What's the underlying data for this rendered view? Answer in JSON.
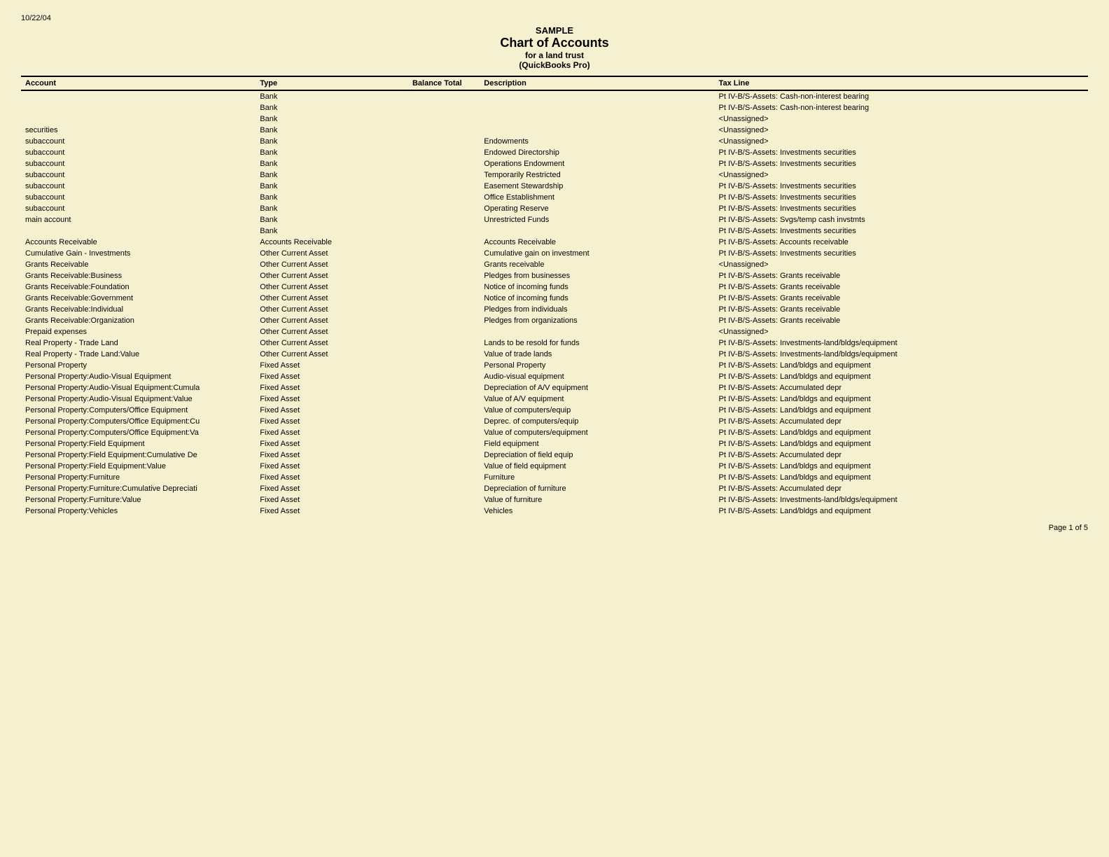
{
  "header": {
    "date": "10/22/04",
    "title1": "SAMPLE",
    "title2": "Chart of Accounts",
    "title3": "for a land trust",
    "title4": "(QuickBooks Pro)"
  },
  "columns": {
    "account": "Account",
    "type": "Type",
    "balance": "Balance Total",
    "description": "Description",
    "taxline": "Tax Line"
  },
  "rows": [
    {
      "account": "",
      "type": "Bank",
      "balance": "",
      "description": "",
      "taxline": "Pt IV-B/S-Assets: Cash-non-interest bearing"
    },
    {
      "account": "",
      "type": "Bank",
      "balance": "",
      "description": "",
      "taxline": "Pt IV-B/S-Assets: Cash-non-interest bearing"
    },
    {
      "account": "",
      "type": "Bank",
      "balance": "",
      "description": "",
      "taxline": "<Unassigned>"
    },
    {
      "account": "securities",
      "type": "Bank",
      "balance": "",
      "description": "",
      "taxline": "<Unassigned>"
    },
    {
      "account": "subaccount",
      "type": "Bank",
      "balance": "",
      "description": "Endowments",
      "taxline": "<Unassigned>"
    },
    {
      "account": "subaccount",
      "type": "Bank",
      "balance": "",
      "description": "Endowed Directorship",
      "taxline": "Pt IV-B/S-Assets: Investments securities"
    },
    {
      "account": "subaccount",
      "type": "Bank",
      "balance": "",
      "description": "Operations Endowment",
      "taxline": "Pt IV-B/S-Assets: Investments securities"
    },
    {
      "account": "subaccount",
      "type": "Bank",
      "balance": "",
      "description": "Temporarily Restricted",
      "taxline": "<Unassigned>"
    },
    {
      "account": "subaccount",
      "type": "Bank",
      "balance": "",
      "description": "Easement Stewardship",
      "taxline": "Pt IV-B/S-Assets: Investments securities"
    },
    {
      "account": "subaccount",
      "type": "Bank",
      "balance": "",
      "description": "Office Establishment",
      "taxline": "Pt IV-B/S-Assets: Investments securities"
    },
    {
      "account": "subaccount",
      "type": "Bank",
      "balance": "",
      "description": "Operating Reserve",
      "taxline": "Pt IV-B/S-Assets: Investments securities"
    },
    {
      "account": "main account",
      "type": "Bank",
      "balance": "",
      "description": "Unrestricted Funds",
      "taxline": "Pt IV-B/S-Assets: Svgs/temp cash invstmts"
    },
    {
      "account": "",
      "type": "Bank",
      "balance": "",
      "description": "",
      "taxline": "Pt IV-B/S-Assets: Investments securities"
    },
    {
      "account": "Accounts Receivable",
      "type": "Accounts Receivable",
      "balance": "",
      "description": "Accounts Receivable",
      "taxline": "Pt IV-B/S-Assets: Accounts receivable"
    },
    {
      "account": "Cumulative Gain - Investments",
      "type": "Other Current Asset",
      "balance": "",
      "description": "Cumulative gain on investment",
      "taxline": "Pt IV-B/S-Assets: Investments securities"
    },
    {
      "account": "Grants Receivable",
      "type": "Other Current Asset",
      "balance": "",
      "description": "Grants receivable",
      "taxline": "<Unassigned>"
    },
    {
      "account": "Grants Receivable:Business",
      "type": "Other Current Asset",
      "balance": "",
      "description": "Pledges from businesses",
      "taxline": "Pt IV-B/S-Assets: Grants receivable"
    },
    {
      "account": "Grants Receivable:Foundation",
      "type": "Other Current Asset",
      "balance": "",
      "description": "Notice of incoming funds",
      "taxline": "Pt IV-B/S-Assets: Grants receivable"
    },
    {
      "account": "Grants Receivable:Government",
      "type": "Other Current Asset",
      "balance": "",
      "description": "Notice of incoming funds",
      "taxline": "Pt IV-B/S-Assets: Grants receivable"
    },
    {
      "account": "Grants Receivable:Individual",
      "type": "Other Current Asset",
      "balance": "",
      "description": "Pledges from individuals",
      "taxline": "Pt IV-B/S-Assets: Grants receivable"
    },
    {
      "account": "Grants Receivable:Organization",
      "type": "Other Current Asset",
      "balance": "",
      "description": "Pledges from organizations",
      "taxline": "Pt IV-B/S-Assets: Grants receivable"
    },
    {
      "account": "Prepaid expenses",
      "type": "Other Current Asset",
      "balance": "",
      "description": "",
      "taxline": "<Unassigned>"
    },
    {
      "account": "Real Property - Trade Land",
      "type": "Other Current Asset",
      "balance": "",
      "description": "Lands to be resold for funds",
      "taxline": "Pt IV-B/S-Assets: Investments-land/bldgs/equipment"
    },
    {
      "account": "Real Property - Trade Land:Value",
      "type": "Other Current Asset",
      "balance": "",
      "description": "Value of trade lands",
      "taxline": "Pt IV-B/S-Assets: Investments-land/bldgs/equipment"
    },
    {
      "account": "Personal Property",
      "type": "Fixed Asset",
      "balance": "",
      "description": "Personal Property",
      "taxline": "Pt IV-B/S-Assets: Land/bldgs and equipment"
    },
    {
      "account": "Personal Property:Audio-Visual Equipment",
      "type": "Fixed Asset",
      "balance": "",
      "description": "Audio-visual equipment",
      "taxline": "Pt IV-B/S-Assets: Land/bldgs and equipment"
    },
    {
      "account": "Personal Property:Audio-Visual Equipment:Cumula",
      "type": "Fixed Asset",
      "balance": "",
      "description": "Depreciation of A/V equipment",
      "taxline": "Pt IV-B/S-Assets: Accumulated depr"
    },
    {
      "account": "Personal Property:Audio-Visual Equipment:Value",
      "type": "Fixed Asset",
      "balance": "",
      "description": "Value of A/V equipment",
      "taxline": "Pt IV-B/S-Assets: Land/bldgs and equipment"
    },
    {
      "account": "Personal Property:Computers/Office Equipment",
      "type": "Fixed Asset",
      "balance": "",
      "description": "Value of computers/equip",
      "taxline": "Pt IV-B/S-Assets: Land/bldgs and equipment"
    },
    {
      "account": "Personal Property:Computers/Office Equipment:Cu",
      "type": "Fixed Asset",
      "balance": "",
      "description": "Deprec. of computers/equip",
      "taxline": "Pt IV-B/S-Assets: Accumulated depr"
    },
    {
      "account": "Personal Property:Computers/Office Equipment:Va",
      "type": "Fixed Asset",
      "balance": "",
      "description": "Value of computers/equipment",
      "taxline": "Pt IV-B/S-Assets: Land/bldgs and equipment"
    },
    {
      "account": "Personal Property:Field Equipment",
      "type": "Fixed Asset",
      "balance": "",
      "description": "Field equipment",
      "taxline": "Pt IV-B/S-Assets: Land/bldgs and equipment"
    },
    {
      "account": "Personal Property:Field Equipment:Cumulative De",
      "type": "Fixed Asset",
      "balance": "",
      "description": "Depreciation of field equip",
      "taxline": "Pt IV-B/S-Assets: Accumulated depr"
    },
    {
      "account": "Personal Property:Field Equipment:Value",
      "type": "Fixed Asset",
      "balance": "",
      "description": "Value of field equipment",
      "taxline": "Pt IV-B/S-Assets: Land/bldgs and equipment"
    },
    {
      "account": "Personal Property:Furniture",
      "type": "Fixed Asset",
      "balance": "",
      "description": "Furniture",
      "taxline": "Pt IV-B/S-Assets: Land/bldgs and equipment"
    },
    {
      "account": "Personal Property:Furniture:Cumulative Depreciati",
      "type": "Fixed Asset",
      "balance": "",
      "description": "Depreciation of furniture",
      "taxline": "Pt IV-B/S-Assets: Accumulated depr"
    },
    {
      "account": "Personal Property:Furniture:Value",
      "type": "Fixed Asset",
      "balance": "",
      "description": "Value of furniture",
      "taxline": "Pt IV-B/S-Assets: Investments-land/bldgs/equipment"
    },
    {
      "account": "Personal Property:Vehicles",
      "type": "Fixed Asset",
      "balance": "",
      "description": "Vehicles",
      "taxline": "Pt IV-B/S-Assets: Land/bldgs and equipment"
    }
  ],
  "footer": {
    "page": "Page 1 of 5"
  }
}
